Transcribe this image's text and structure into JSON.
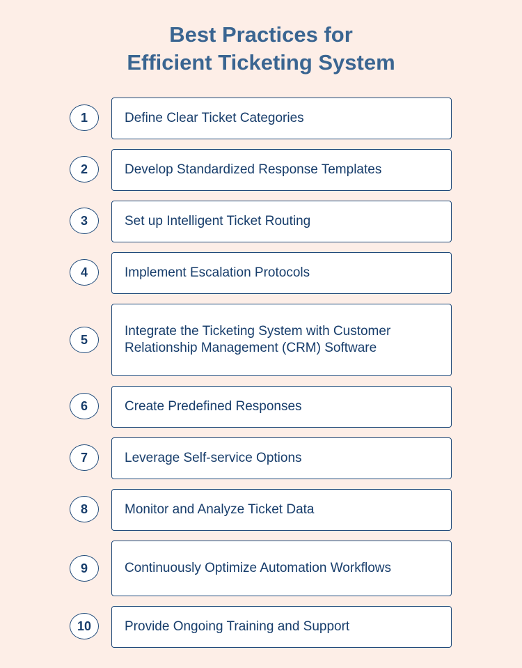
{
  "title_line1": "Best Practices for",
  "title_line2": "Efficient Ticketing System",
  "items": [
    {
      "number": "1",
      "text": "Define Clear Ticket Categories"
    },
    {
      "number": "2",
      "text": "Develop Standardized Response Templates"
    },
    {
      "number": "3",
      "text": "Set up Intelligent Ticket Routing"
    },
    {
      "number": "4",
      "text": "Implement Escalation Protocols"
    },
    {
      "number": "5",
      "text": "Integrate the Ticketing System with Customer Relationship Management (CRM) Software"
    },
    {
      "number": "6",
      "text": "Create Predefined Responses"
    },
    {
      "number": "7",
      "text": "Leverage Self-service Options"
    },
    {
      "number": "8",
      "text": "Monitor and Analyze Ticket Data"
    },
    {
      "number": "9",
      "text": "Continuously Optimize Automation Workflows"
    },
    {
      "number": "10",
      "text": "Provide Ongoing Training and Support"
    }
  ]
}
